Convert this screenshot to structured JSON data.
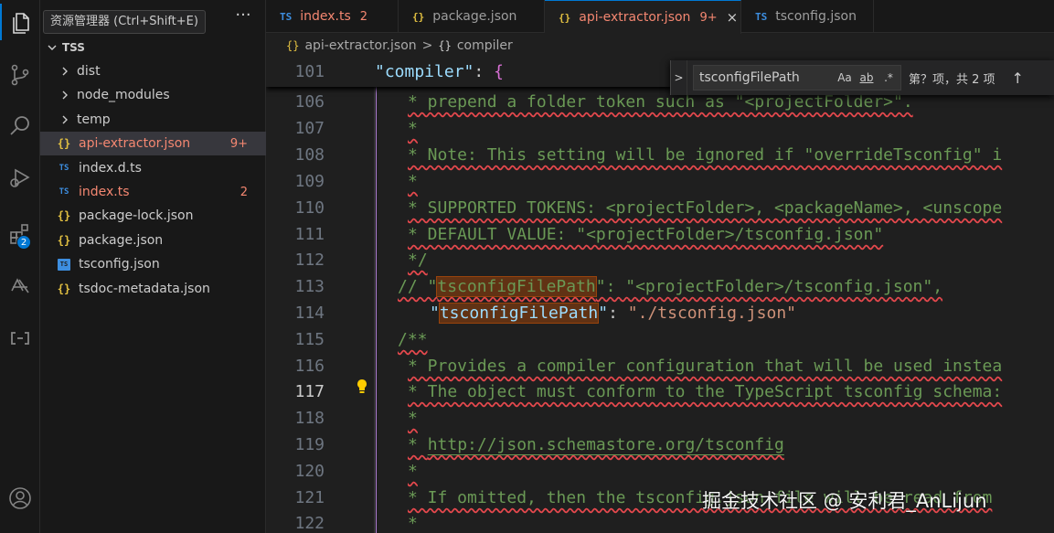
{
  "tooltip": "资源管理器 (Ctrl+Shift+E)",
  "activity_bar": {
    "extensions_badge": "2",
    "items": [
      "explorer-icon",
      "source-control-icon",
      "search-icon",
      "run-debug-icon",
      "extensions-icon",
      "remote-icon",
      "debug-console-icon",
      "account-icon"
    ]
  },
  "sidebar": {
    "more_label": "···",
    "root": "TSS",
    "items": [
      {
        "label": "dist",
        "kind": "folder"
      },
      {
        "label": "node_modules",
        "kind": "folder"
      },
      {
        "label": "temp",
        "kind": "folder"
      },
      {
        "label": "api-extractor.json",
        "kind": "json",
        "count": "9+",
        "selected": true
      },
      {
        "label": "index.d.ts",
        "kind": "ts"
      },
      {
        "label": "index.ts",
        "kind": "ts",
        "count": "2"
      },
      {
        "label": "package-lock.json",
        "kind": "json"
      },
      {
        "label": "package.json",
        "kind": "json"
      },
      {
        "label": "tsconfig.json",
        "kind": "tsconfig"
      },
      {
        "label": "tsdoc-metadata.json",
        "kind": "json"
      }
    ]
  },
  "tabs": [
    {
      "icon": "TS",
      "label": "index.ts",
      "count": "2"
    },
    {
      "icon": "{}",
      "label": "package.json"
    },
    {
      "icon": "{}",
      "label": "api-extractor.json",
      "count": "9+",
      "close": "×",
      "active": true
    },
    {
      "icon": "TS",
      "label": "tsconfig.json"
    }
  ],
  "breadcrumb": {
    "icon1": "{}",
    "file": "api-extractor.json",
    "separator": ">",
    "icon2": "{}",
    "symbol": "compiler"
  },
  "find": {
    "toggle": ">",
    "value": "tsconfigFilePath",
    "match_case": "Aa",
    "whole_word": "ab",
    "regex": ".*",
    "result": "第？项，共 2 项",
    "prev": "↑"
  },
  "editor": {
    "sticky": {
      "num": "101",
      "key": "\"compiler\"",
      "colon": ": ",
      "brace": "{"
    },
    "lines": [
      {
        "num": "106",
        "text": "* prepend a folder token such as \"<projectFolder>\"."
      },
      {
        "num": "107",
        "text": "*"
      },
      {
        "num": "108",
        "text": "* Note: This setting will be ignored if \"overrideTsconfig\" i"
      },
      {
        "num": "109",
        "text": "*"
      },
      {
        "num": "110",
        "text": "* SUPPORTED TOKENS: <projectFolder>, <packageName>, <unscope"
      },
      {
        "num": "111",
        "text": "* DEFAULT VALUE: \"<projectFolder>/tsconfig.json\""
      },
      {
        "num": "112",
        "text": "*/"
      },
      {
        "num": "113",
        "pre": "// \"",
        "match": "tsconfigFilePath",
        "post": "\": \"<projectFolder>/tsconfig.json\","
      },
      {
        "num": "114",
        "pre": "\"",
        "match": "tsconfigFilePath",
        "post1": "\"",
        "post2": ": ",
        "val": "\"./tsconfig.json\""
      },
      {
        "num": "115",
        "text": "/**"
      },
      {
        "num": "116",
        "text": "* Provides a compiler configuration that will be used instea"
      },
      {
        "num": "117",
        "text": "* The object must conform to the TypeScript tsconfig schema:"
      },
      {
        "num": "118",
        "text": "*"
      },
      {
        "num": "119",
        "pre": "* ",
        "link": "http://json.schemastore.org/tsconfig"
      },
      {
        "num": "120",
        "text": "*"
      },
      {
        "num": "121",
        "text": "* If omitted, then the tsconfig.json file will be read from"
      },
      {
        "num": "122",
        "text": "*"
      }
    ],
    "current_line": "117"
  },
  "watermark": "掘金技术社区 @ 安利君_AnLijun"
}
